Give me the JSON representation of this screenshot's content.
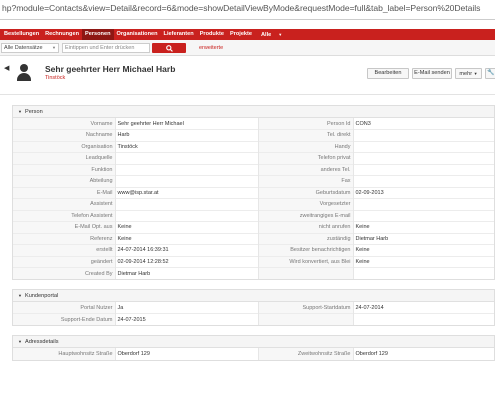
{
  "url": "hp?module=Contacts&view=Detail&record=6&mode=showDetailViewByMode&requestMode=full&tab_label=Person%20Details",
  "nav": {
    "items": [
      "Bestellungen",
      "Rechnungen",
      "Personen",
      "Organisationen",
      "Lieferanten",
      "Produkte",
      "Projekte",
      "Alle"
    ],
    "active": "Personen",
    "accent": "#c9211e"
  },
  "search": {
    "scope": "Alle Datensätze",
    "placeholder": "Eintippen und Enter drücken",
    "advanced": "erweiterte"
  },
  "record": {
    "name": "Sehr geehrter Herr Michael Harb",
    "organisation": "Tinstöck"
  },
  "actions": {
    "edit": "Bearbeiten",
    "email": "E-Mail senden",
    "more": "mehr"
  },
  "sections": [
    {
      "title": "Person",
      "rows": [
        [
          "Vorname",
          "Sehr geehrter Herr Michael",
          "Person Id",
          "CON3"
        ],
        [
          "Nachname",
          "Harb",
          "Tel. direkt",
          ""
        ],
        [
          "Organisation",
          "Tinstöck",
          "Handy",
          ""
        ],
        [
          "Leadquelle",
          "",
          "Telefon privat",
          ""
        ],
        [
          "Funktion",
          "",
          "anderes Tel.",
          ""
        ],
        [
          "Abteilung",
          "",
          "Fax",
          ""
        ],
        [
          "E-Mail",
          "www@isp.star.at",
          "Geburtsdatum",
          "02-09-2013"
        ],
        [
          "Assistent",
          "",
          "Vorgesetzter",
          ""
        ],
        [
          "Telefon Assistent",
          "",
          "zweitrangiges E-mail",
          ""
        ],
        [
          "E-Mail Opt. aus",
          "Keine",
          "nicht anrufen",
          "Keine"
        ],
        [
          "Referenz",
          "Keine",
          "zuständig",
          "Dietmar Harb"
        ],
        [
          "erstellt",
          "24-07-2014 16:39:31",
          "Besitzer benachrichtigen",
          "Keine"
        ],
        [
          "geändert",
          "02-09-2014 12:28:52",
          "Wird konvertiert, aus Blei",
          "Keine"
        ],
        [
          "Created By",
          "Dietmar Harb",
          "",
          ""
        ]
      ]
    },
    {
      "title": "Kundenportal",
      "rows": [
        [
          "Portal Nutzer",
          "Ja",
          "Support-Startdatum",
          "24-07-2014"
        ],
        [
          "Support-Ende Datum",
          "24-07-2015",
          "",
          ""
        ]
      ]
    },
    {
      "title": "Adressdetails",
      "rows": [
        [
          "Hauptwohnsitz Straße",
          "Oberdorf 129",
          "Zweitwohnsitz Straße",
          "Oberdorf 129"
        ]
      ]
    }
  ]
}
